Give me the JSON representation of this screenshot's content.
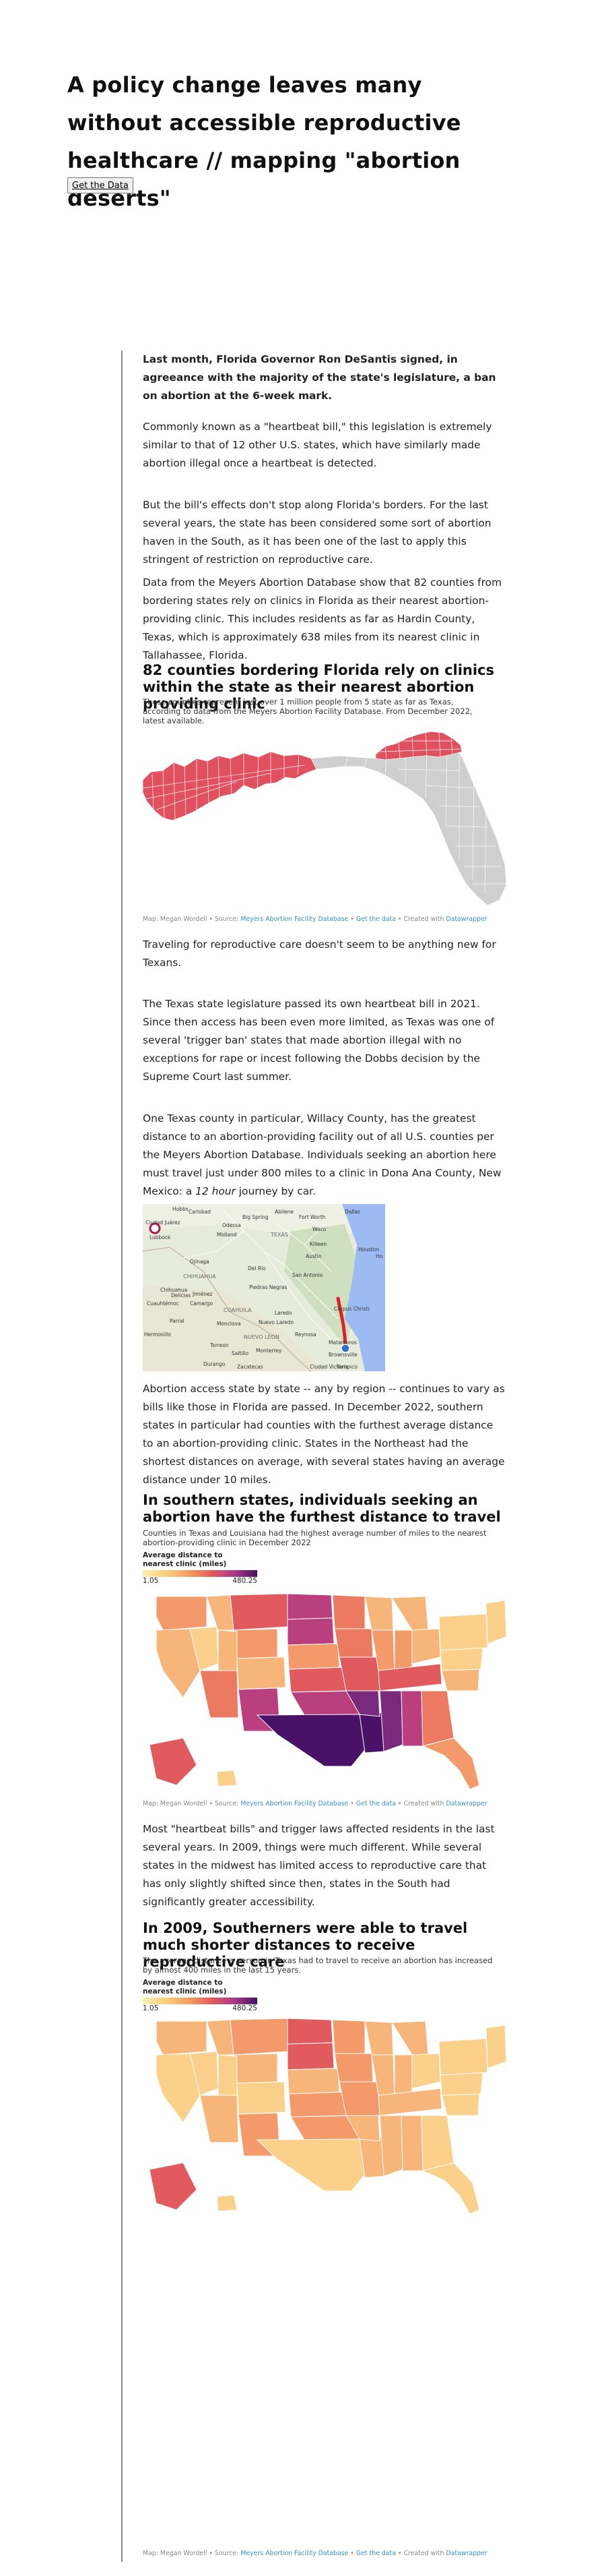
{
  "header": {
    "title": "A policy change leaves many without accessible reproductive healthcare // mapping \"abortion deserts\"",
    "data_button": "Get the Data"
  },
  "intro": {
    "lead": "Last month, Florida Governor Ron DeSantis signed, in agreeance with the majority of the state's legislature, a ban on abortion at the 6-week mark.",
    "p1": "Commonly known as a \"heartbeat bill,\" this legislation is extremely similar to that of 12 other U.S. states, which have similarly made abortion illegal once a heartbeat is detected.",
    "p2": "But the bill's effects don't stop along Florida's borders. For the last several years, the state has been considered some sort of abortion haven in the South, as it has been one of the last to apply this stringent of restriction on reproductive care.",
    "p3": "Data from the Meyers Abortion Database show that 82 counties from bordering states rely on clinics in Florida as their nearest abortion-providing clinic. This includes residents as far as Hardin County, Texas, which is approximately 638 miles from its nearest clinic in Tallahassee, Florida."
  },
  "map1": {
    "title": "82 counties bordering Florida rely on clinics within the state as their nearest abortion providing clinic",
    "description": "These counties represent just over 1 million people from 5 state as far as Texas, according to data from the Meyers Abortion Facility Database. From December 2022, latest available.",
    "colors": {
      "highlight": "#e0505f",
      "base": "#cfcfcf"
    }
  },
  "source_line": {
    "prefix": "Map: Megan Wordell • Source: ",
    "source_link": "Meyers Abortion Facility Database",
    "sep1": " • ",
    "data_link": "Get the data",
    "sep2": " • Created with ",
    "tool_link": "Datawrapper"
  },
  "texas": {
    "p1": "Traveling for reproductive care doesn't seem to be anything new for Texans.",
    "p2": "The Texas state legislature passed its own heartbeat bill in 2021. Since then access has been even more limited, as Texas was one of several 'trigger ban' states that made abortion illegal with no exceptions for rape or incest following the Dobbs decision by the Supreme Court last summer.",
    "p3_before": "One Texas county in particular, Willacy County, has the greatest distance to an abortion-providing facility out of all U.S. counties per the Meyers Abortion Database. Individuals seeking an abortion here must travel just under 800 miles to a clinic in Dona Ana County, New Mexico: a ",
    "p3_em": "12 hour",
    "p3_after": " journey by car."
  },
  "route_map": {
    "labels": [
      "Lubbock",
      "Fort Worth",
      "Dallas",
      "TEXAS",
      "Austin",
      "San Antonio",
      "Houston",
      "Corpus Christi",
      "CHIHUAHUA",
      "COAHUILA",
      "NUEVO LEÓN",
      "Monterrey",
      "Chihuahua",
      "Torreon",
      "Saltillo",
      "Ciudad Juárez",
      "Odessa",
      "Midland",
      "Big Spring",
      "Abilene",
      "Killeen",
      "Waco",
      "Del Rio",
      "Piedras Negras",
      "Laredo",
      "Nuevo Laredo",
      "Matamoros",
      "Brownsville",
      "Ciudad Victoria",
      "Cuauhtémoc",
      "Delicias",
      "Camargo",
      "Monclova",
      "Reynosa",
      "Ojinaga",
      "Hobbs",
      "Carlsbad",
      "Jiménez",
      "Parral",
      "Durango",
      "Zacatecas",
      "Hermosillo",
      "Tampico",
      "Ho"
    ]
  },
  "region": {
    "p1": "Abortion access state by state -- any by region -- continues to vary as bills like those in Florida are passed. In December 2022, southern states in particular had counties with the furthest average distance to an abortion-providing clinic. States in the Northeast had the shortest distances on average, with several states having an average distance under 10 miles."
  },
  "map2": {
    "title": "In southern states, individuals seeking an abortion have the furthest distance to travel",
    "description": "Counties in Texas and Louisiana had the highest average number of miles to the nearest abortion-providing clinic in December 2022",
    "legend_title": "Average distance to nearest clinic (miles)",
    "legend_min": "1.05",
    "legend_max": "480.25"
  },
  "history": {
    "p1": "Most \"heartbeat bills\" and trigger laws affected residents in the last several years. In 2009, things were much different. While several states in the midwest has limited access to reproductive care that has only slightly shifted since then, states in the South had significantly greater accessibility."
  },
  "map3": {
    "title": "In 2009, Southerners were able to travel much shorter distances to receive reproductive care",
    "description": "The average distance a person in Texas had to travel to receive an abortion has increased by almost 400 miles in the last 15 years.",
    "legend_title": "Average distance to nearest clinic (miles)",
    "legend_min": "1.05",
    "legend_max": "480.25"
  }
}
